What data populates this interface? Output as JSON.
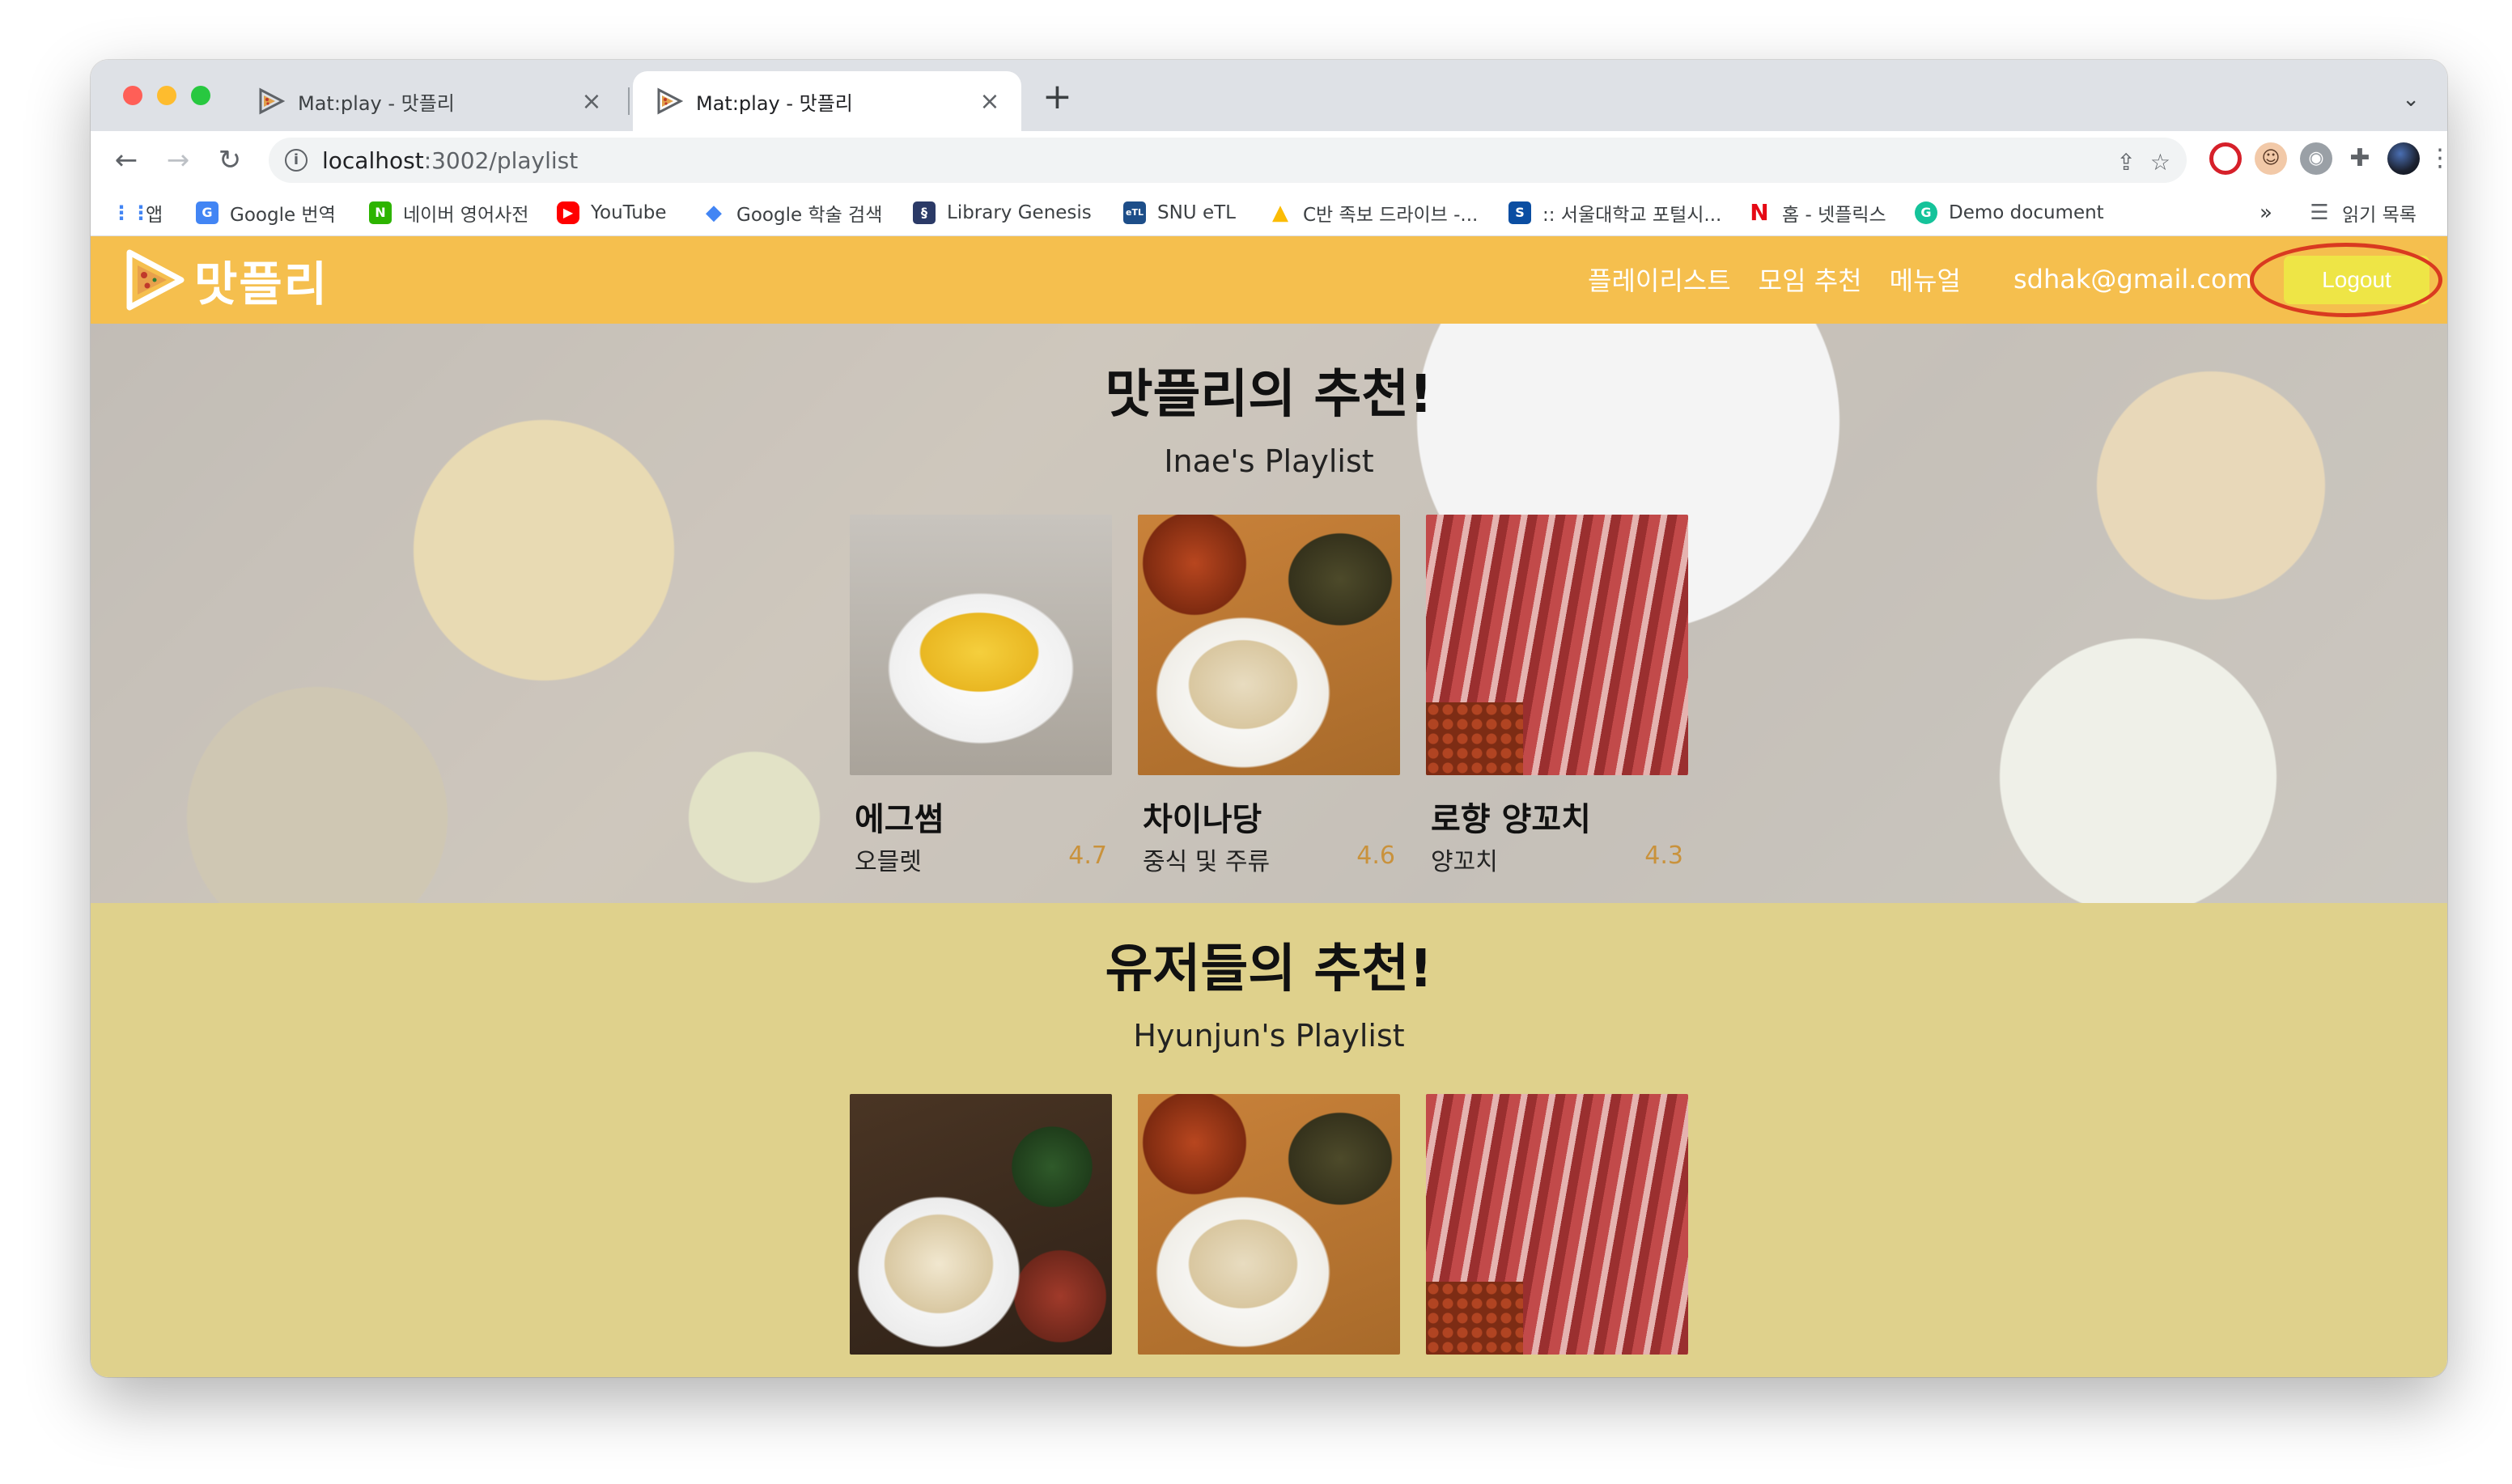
{
  "browser": {
    "tabs": [
      {
        "title": "Mat:play - 맛플리",
        "active": false
      },
      {
        "title": "Mat:play - 맛플리",
        "active": true
      }
    ],
    "url_host": "localhost",
    "url_path": ":3002/playlist",
    "bookmarks": [
      {
        "label": "앱",
        "icon": "apps-grid-icon",
        "color": "#4285f4"
      },
      {
        "label": "Google 번역",
        "icon": "google-translate-icon",
        "color": "#4285f4"
      },
      {
        "label": "네이버 영어사전",
        "icon": "naver-dictionary-icon",
        "color": "#2db400"
      },
      {
        "label": "YouTube",
        "icon": "youtube-icon",
        "color": "#ff0000"
      },
      {
        "label": "Google 학술 검색",
        "icon": "google-scholar-icon",
        "color": "#4285f4"
      },
      {
        "label": "Library Genesis",
        "icon": "library-genesis-icon",
        "color": "#2b3a67"
      },
      {
        "label": "SNU eTL",
        "icon": "snu-etl-icon",
        "color": "#1d4e89"
      },
      {
        "label": "C반 족보 드라이브 -...",
        "icon": "google-drive-icon",
        "color": "#fbbc04"
      },
      {
        "label": ":: 서울대학교 포털시...",
        "icon": "snu-portal-icon",
        "color": "#0b4ea2"
      },
      {
        "label": "홈 - 넷플릭스",
        "icon": "netflix-icon",
        "color": "#e50914"
      },
      {
        "label": "Demo document",
        "icon": "grammarly-icon",
        "color": "#15c39a"
      }
    ],
    "bookmarks_more": "»",
    "reading_list": "읽기 목록"
  },
  "navbar": {
    "logo_text": "맛플리",
    "links": [
      "플레이리스트",
      "모임 추천",
      "메뉴얼"
    ],
    "email": "sdhak@gmail.com",
    "logout_label": "Logout",
    "accent_color": "#f5bf4e"
  },
  "section1": {
    "title": "맛플리의 추천!",
    "subtitle": "Inae's Playlist",
    "cards": [
      {
        "name": "에그썸",
        "category": "오믈렛",
        "rating": "4.7",
        "photo": "photo-egg"
      },
      {
        "name": "차이나당",
        "category": "중식 및 주류",
        "rating": "4.6",
        "photo": "photo-china"
      },
      {
        "name": "로향 양꼬치",
        "category": "양꼬치",
        "rating": "4.3",
        "photo": "photo-lamb"
      }
    ]
  },
  "section2": {
    "title": "유저들의 추천!",
    "subtitle": "Hyunjun's Playlist",
    "cards": [
      {
        "photo": "photo-noodle"
      },
      {
        "photo": "photo-china"
      },
      {
        "photo": "photo-lamb"
      }
    ]
  }
}
